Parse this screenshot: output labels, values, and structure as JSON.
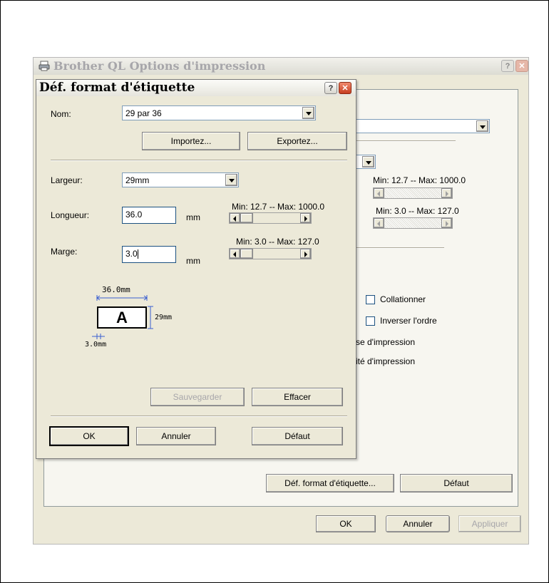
{
  "main_window": {
    "title": "Brother QL Options d'impression",
    "help_btn": "?",
    "close_btn": "✕",
    "min_max_1": "Min: 12.7 -- Max: 1000.0",
    "min_max_2": "Min: 3.0 -- Max: 127.0",
    "collate_label": "Collationner",
    "reverse_label": "Inverser l'ordre",
    "partial_1": "se d'impression",
    "partial_2": "ité d'impression",
    "def_format_btn": "Déf. format d'étiquette...",
    "default_btn": "Défaut",
    "ok_btn": "OK",
    "cancel_btn": "Annuler",
    "apply_btn": "Appliquer"
  },
  "dialog": {
    "title": "Déf. format d'étiquette",
    "help_btn": "?",
    "close_btn": "✕",
    "name_label": "Nom:",
    "name_value": "29 par 36",
    "import_btn": "Importez...",
    "export_btn": "Exportez...",
    "width_label": "Largeur:",
    "width_value": "29mm",
    "length_label": "Longueur:",
    "length_value": "36.0",
    "length_unit": "mm",
    "length_range": "Min: 12.7 -- Max: 1000.0",
    "margin_label": "Marge:",
    "margin_value": "3.0",
    "margin_unit": "mm",
    "margin_range": "Min: 3.0 -- Max: 127.0",
    "preview": {
      "length_dim": "36.0mm",
      "height_dim": "29mm",
      "margin_dim": "3.0mm",
      "letter": "A"
    },
    "save_btn": "Sauvegarder",
    "delete_btn": "Effacer",
    "ok_btn": "OK",
    "cancel_btn": "Annuler",
    "default_btn": "Défaut"
  }
}
